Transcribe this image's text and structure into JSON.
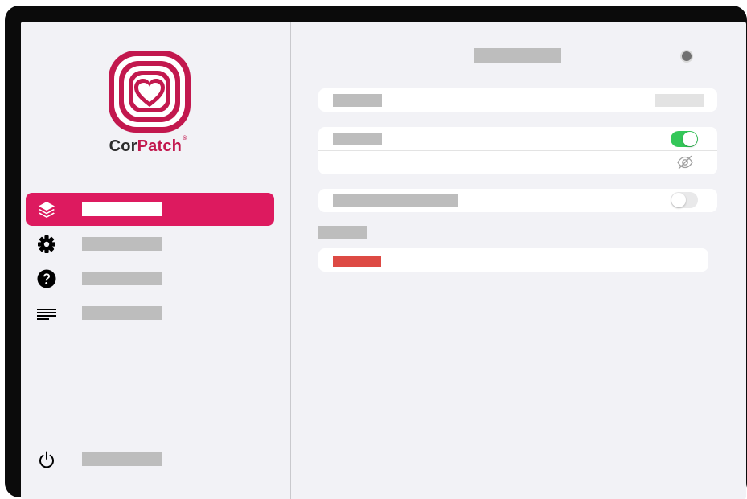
{
  "brand": {
    "logo_text_cor": "Cor",
    "logo_text_patch": "Patch",
    "registered_mark": "®",
    "brand_color": "#c2184e"
  },
  "sidebar": {
    "items": [
      {
        "label": "",
        "icon": "layers-icon",
        "active": true
      },
      {
        "label": "",
        "icon": "gear-icon",
        "active": false
      },
      {
        "label": "",
        "icon": "help-icon",
        "active": false
      },
      {
        "label": "",
        "icon": "menu-lines-icon",
        "active": false
      }
    ],
    "footer": {
      "label": "",
      "icon": "power-icon"
    },
    "active_color": "#dd1a5f"
  },
  "main": {
    "title": "",
    "rows": [
      {
        "label": "",
        "value": ""
      },
      {
        "label": "",
        "toggle_on": true
      },
      {
        "icon": "eye-slash-icon"
      },
      {
        "label": "",
        "toggle_on": false
      }
    ],
    "section_header": "",
    "danger_action": {
      "label": "",
      "color": "#dd4a44"
    },
    "toggle_on_color": "#34c759"
  }
}
